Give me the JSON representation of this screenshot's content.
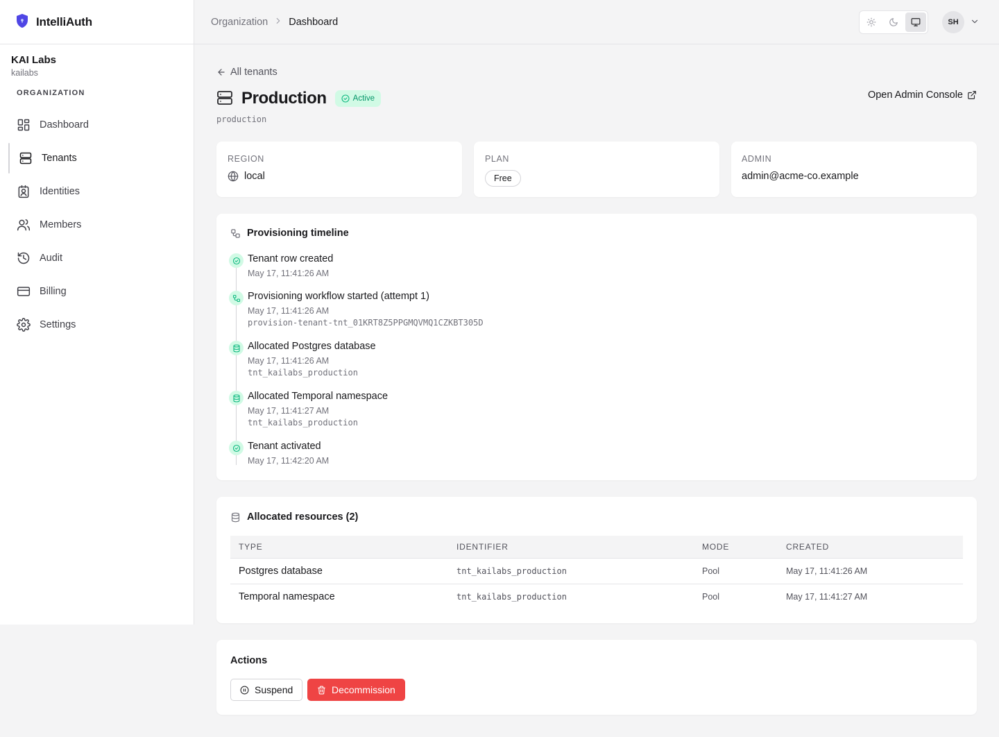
{
  "app": {
    "name": "IntelliAuth"
  },
  "org": {
    "name": "KAI Labs",
    "slug": "kailabs"
  },
  "sidebar": {
    "section_label": "ORGANIZATION",
    "items": [
      {
        "label": "Dashboard",
        "icon": "dashboard-icon"
      },
      {
        "label": "Tenants",
        "icon": "server-icon",
        "active": true
      },
      {
        "label": "Identities",
        "icon": "id-badge-icon"
      },
      {
        "label": "Members",
        "icon": "users-icon"
      },
      {
        "label": "Audit",
        "icon": "history-icon"
      },
      {
        "label": "Billing",
        "icon": "credit-card-icon"
      },
      {
        "label": "Settings",
        "icon": "gear-icon"
      }
    ]
  },
  "header": {
    "breadcrumb": [
      "Organization",
      "Dashboard"
    ],
    "theme_options": [
      "light",
      "dark",
      "system"
    ],
    "theme_selected": "system",
    "user_initials": "SH"
  },
  "tenant": {
    "back_label": "All tenants",
    "name": "Production",
    "status": "Active",
    "slug": "production",
    "admin_console_label": "Open Admin Console",
    "region_label": "REGION",
    "region": "local",
    "plan_label": "PLAN",
    "plan": "Free",
    "admin_label": "ADMIN",
    "admin": "admin@acme-co.example"
  },
  "timeline": {
    "title": "Provisioning timeline",
    "events": [
      {
        "title": "Tenant row created",
        "time": "May 17, 11:41:26 AM",
        "icon": "check-circle-icon"
      },
      {
        "title": "Provisioning workflow started (attempt 1)",
        "time": "May 17, 11:41:26 AM",
        "ref": "provision-tenant-tnt_01KRT8Z5PPGMQVMQ1CZKBT305D",
        "icon": "workflow-icon"
      },
      {
        "title": "Allocated Postgres database",
        "time": "May 17, 11:41:26 AM",
        "ref": "tnt_kailabs_production",
        "icon": "database-icon"
      },
      {
        "title": "Allocated Temporal namespace",
        "time": "May 17, 11:41:27 AM",
        "ref": "tnt_kailabs_production",
        "icon": "database-icon"
      },
      {
        "title": "Tenant activated",
        "time": "May 17, 11:42:20 AM",
        "icon": "check-circle-icon"
      }
    ]
  },
  "resources": {
    "title": "Allocated resources (2)",
    "columns": [
      "TYPE",
      "IDENTIFIER",
      "MODE",
      "CREATED"
    ],
    "rows": [
      [
        "Postgres database",
        "tnt_kailabs_production",
        "Pool",
        "May 17, 11:41:26 AM"
      ],
      [
        "Temporal namespace",
        "tnt_kailabs_production",
        "Pool",
        "May 17, 11:41:27 AM"
      ]
    ]
  },
  "actions": {
    "title": "Actions",
    "suspend_label": "Suspend",
    "decommission_label": "Decommission"
  },
  "colors": {
    "accent_shield": "#4f46e5",
    "active_badge_bg": "#d1fae5",
    "active_badge_text": "#059669",
    "danger": "#ef4444"
  }
}
